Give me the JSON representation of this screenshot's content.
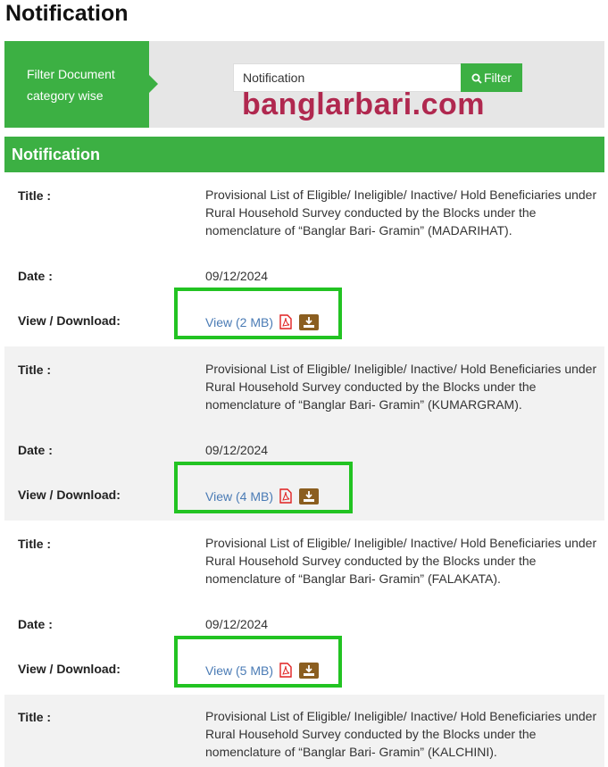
{
  "page": {
    "title": "Notification"
  },
  "filter": {
    "label": "Filter Document category wise",
    "input_value": "Notification",
    "button_label": "Filter"
  },
  "watermark": "banglarbari.com",
  "section": {
    "title": "Notification"
  },
  "labels": {
    "title": "Title :",
    "date": "Date :",
    "view_download": "View / Download:"
  },
  "notifications": [
    {
      "title": "Provisional List of Eligible/ Ineligible/ Inactive/ Hold Beneficiaries under Rural Household Survey conducted by the Blocks under the nomenclature of “Banglar Bari- Gramin” (MADARIHAT).",
      "date": "09/12/2024",
      "view_label": "View (2 MB)"
    },
    {
      "title": "Provisional List of Eligible/ Ineligible/ Inactive/ Hold Beneficiaries under Rural Household Survey conducted by the Blocks under the nomenclature of “Banglar Bari- Gramin” (KUMARGRAM).",
      "date": "09/12/2024",
      "view_label": "View (4 MB)"
    },
    {
      "title": "Provisional List of Eligible/ Ineligible/ Inactive/ Hold Beneficiaries under Rural Household Survey conducted by the Blocks under the nomenclature of “Banglar Bari- Gramin” (FALAKATA).",
      "date": "09/12/2024",
      "view_label": "View (5 MB)"
    },
    {
      "title": "Provisional List of Eligible/ Ineligible/ Inactive/ Hold Beneficiaries under Rural Household Survey conducted by the Blocks under the nomenclature of “Banglar Bari- Gramin” (KALCHINI).",
      "date": "",
      "view_label": ""
    }
  ],
  "colors": {
    "accent": "#3cb043",
    "highlight_box": "#22c322",
    "link": "#4a7bb5",
    "pdf": "#e02020",
    "download": "#8b5e20",
    "watermark": "#b0284f"
  },
  "icons": {
    "search": "search-icon",
    "pdf": "pdf-icon",
    "download": "download-icon"
  }
}
